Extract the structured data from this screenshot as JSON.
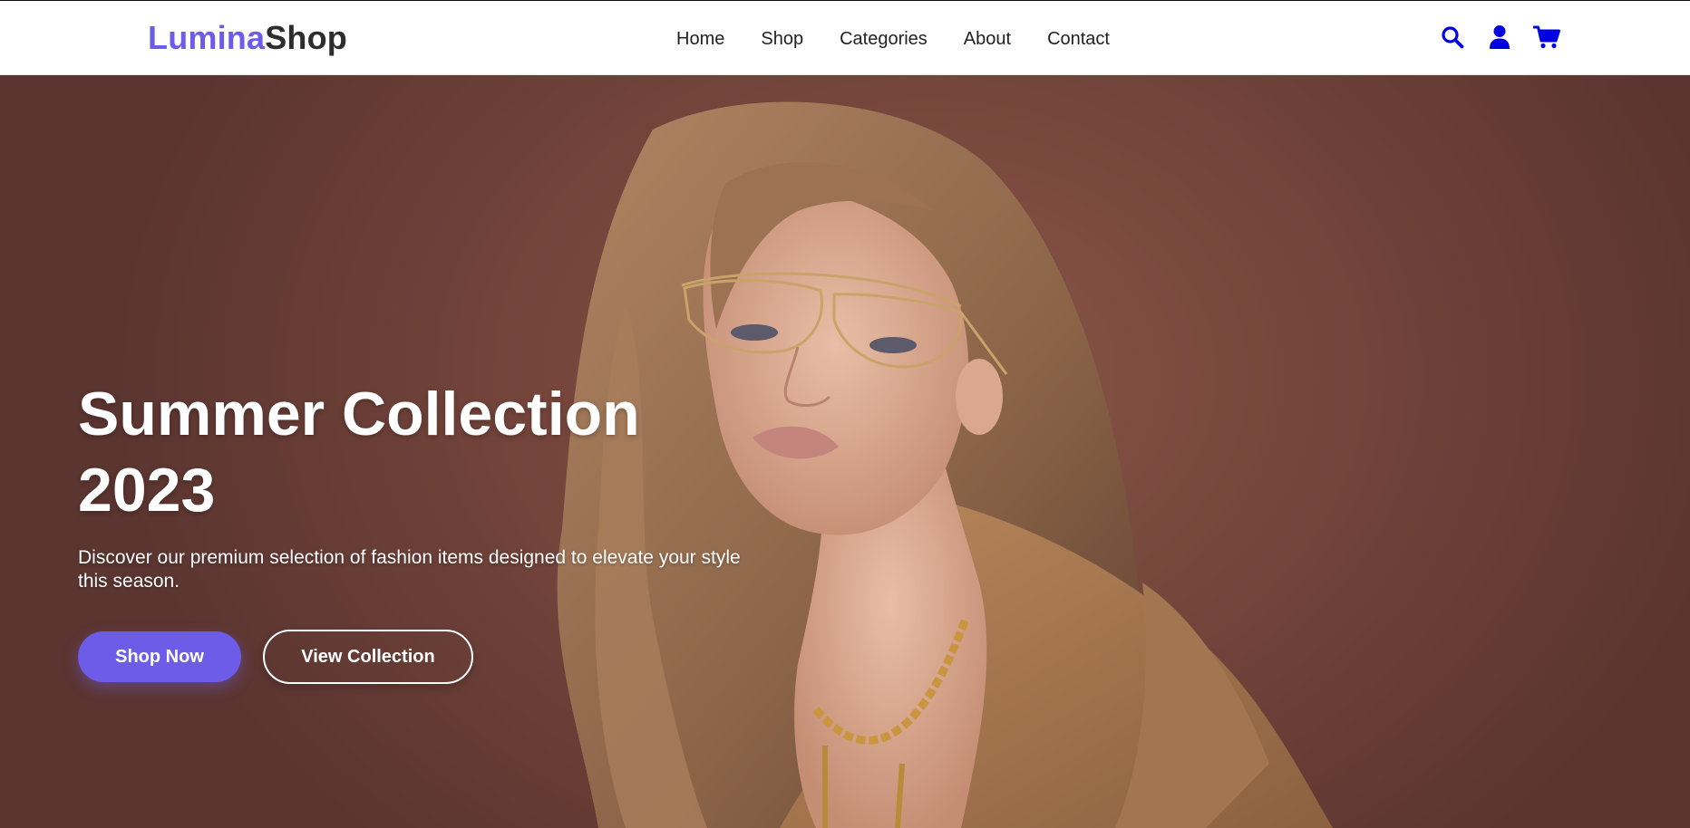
{
  "brand": {
    "part1": "Lumina",
    "part2": "Shop",
    "color_accent": "#6c5ce7",
    "color_dark": "#2d2d2d"
  },
  "nav": {
    "items": [
      {
        "label": "Home"
      },
      {
        "label": "Shop"
      },
      {
        "label": "Categories"
      },
      {
        "label": "About"
      },
      {
        "label": "Contact"
      }
    ]
  },
  "header_icons": {
    "color": "#0000e0",
    "search": "search-icon",
    "account": "user-icon",
    "cart": "cart-icon"
  },
  "hero": {
    "title_line1": "Summer Collection",
    "title_line2": "2023",
    "description": "Discover our premium selection of fashion items designed to elevate your style this season.",
    "primary_button": "Shop Now",
    "secondary_button": "View Collection",
    "background_color": "#76463c"
  }
}
